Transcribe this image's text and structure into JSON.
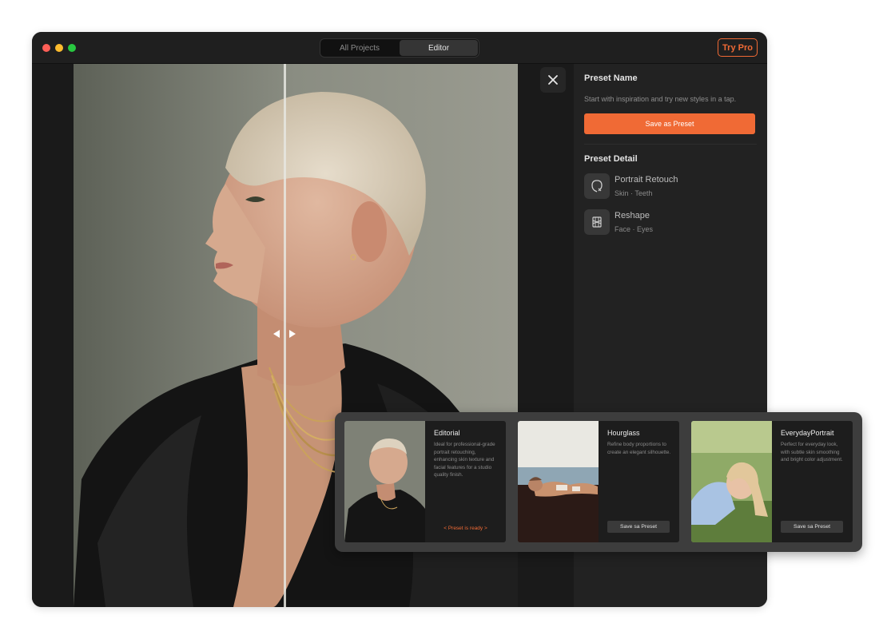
{
  "titlebar": {
    "tabs": [
      {
        "label": "All Projects",
        "active": false
      },
      {
        "label": "Editor",
        "active": true
      }
    ],
    "try_pro_label": "Try Pro"
  },
  "panel": {
    "preset_name_title": "Preset Name",
    "description": "Start with inspiration and try new styles in a tap.",
    "save_label": "Save as Preset",
    "preset_detail_title": "Preset Detail",
    "details": [
      {
        "name": "Portrait Retouch",
        "sub": "Skin · Teeth",
        "icon": "face-retouch-icon"
      },
      {
        "name": "Reshape",
        "sub": "Face · Eyes",
        "icon": "body-reshape-icon"
      }
    ]
  },
  "presets": [
    {
      "title": "Editorial",
      "description": "Ideal for professional-grade portrait retouching, enhancing skin texture and facial features for a studio quality finish.",
      "status": "< Preset is ready >"
    },
    {
      "title": "Hourglass",
      "description": "Refine body proportions to create an elegant silhouette.",
      "button": "Save sa Preset"
    },
    {
      "title": "EverydayPortrait",
      "description": "Perfect for everyday look, with subtle skin smoothing and bright color adjustment.",
      "button": "Save sa Preset"
    }
  ],
  "colors": {
    "accent": "#f06a35",
    "window_bg": "#1a1a1a",
    "panel_bg": "#222222",
    "tray_bg": "#3d3d3d"
  }
}
